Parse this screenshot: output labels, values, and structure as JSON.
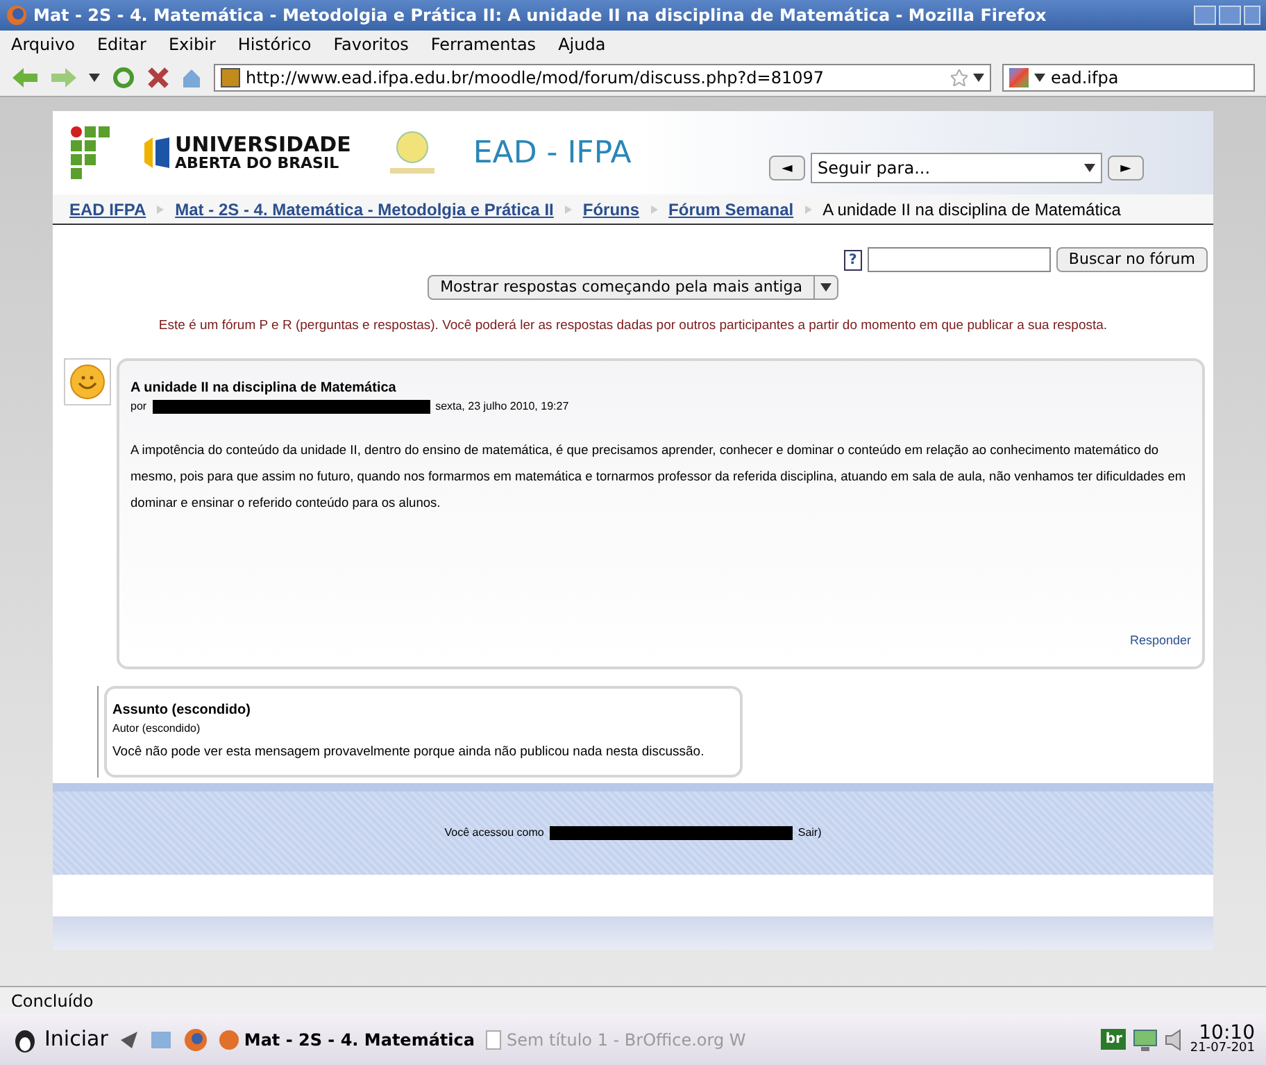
{
  "window": {
    "title": "Mat - 2S - 4. Matemática - Metodolgia e Prática II: A unidade II na disciplina de Matemática - Mozilla Firefox"
  },
  "menu": [
    "Arquivo",
    "Editar",
    "Exibir",
    "Histórico",
    "Favoritos",
    "Ferramentas",
    "Ajuda"
  ],
  "address": {
    "value": "http://www.ead.ifpa.edu.br/moodle/mod/forum/discuss.php?d=81097"
  },
  "search_engine": {
    "value": "ead.ifpa"
  },
  "header": {
    "uab_line1": "UNIVERSIDADE",
    "uab_line2": "ABERTA DO BRASIL",
    "site_title": "EAD - IFPA",
    "jump_prev": "◄",
    "jump_select": "Seguir para...",
    "jump_next": "►"
  },
  "breadcrumb": [
    {
      "label": "EAD IFPA",
      "link": true
    },
    {
      "label": "Mat - 2S - 4. Matemática - Metodolgia e Prática II",
      "link": true
    },
    {
      "label": "Fóruns",
      "link": true
    },
    {
      "label": "Fórum Semanal",
      "link": true
    },
    {
      "label": "A unidade II na disciplina de Matemática",
      "link": false
    }
  ],
  "forum_search": {
    "help": "?",
    "button": "Buscar no fórum"
  },
  "sort_select": {
    "value": "Mostrar respostas começando pela mais antiga"
  },
  "notice": "Este é um fórum P e R (perguntas e respostas). Você poderá ler as respostas dadas por outros participantes a partir do momento em que publicar a sua resposta.",
  "post": {
    "subject": "A unidade II na disciplina de Matemática",
    "by": "por",
    "date": "sexta, 23 julho 2010, 19:27",
    "body": "A impotência do conteúdo da unidade II, dentro do ensino de matemática, é que precisamos aprender, conhecer e dominar o conteúdo em relação ao conhecimento matemático do mesmo, pois para que assim no futuro, quando nos formarmos em matemática e tornarmos professor da referida disciplina, atuando em sala de aula, não venhamos ter dificuldades em dominar e ensinar o referido conteúdo para os alunos.",
    "reply": "Responder"
  },
  "hidden_post": {
    "subject": "Assunto (escondido)",
    "author": "Autor (escondido)",
    "body": "Você não pode ver esta mensagem provavelmente porque ainda não publicou nada nesta discussão."
  },
  "footer": {
    "logged_in": "Você acessou como",
    "logout": "Sair)"
  },
  "status_bar": "Concluído",
  "taskbar": {
    "start": "Iniciar",
    "tasks": [
      {
        "label": "Mat - 2S - 4. Matemática",
        "selected": true
      },
      {
        "label": "Sem título 1 - BrOffice.org W",
        "selected": false
      }
    ],
    "tray_badge": "br",
    "time": "10:10",
    "date": "21-07-201"
  }
}
